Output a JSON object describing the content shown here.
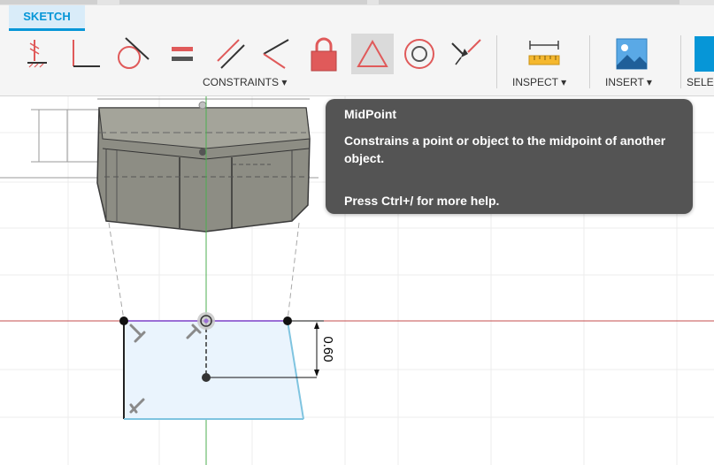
{
  "toolbar": {
    "active_tab": "SKETCH",
    "groups": {
      "constraints": "CONSTRAINTS ▾",
      "inspect": "INSPECT ▾",
      "insert": "INSERT ▾",
      "select": "SELE"
    },
    "tools": [
      {
        "name": "fix-unfix-icon"
      },
      {
        "name": "perpendicular-icon"
      },
      {
        "name": "tangent-icon"
      },
      {
        "name": "equal-icon"
      },
      {
        "name": "parallel-icon"
      },
      {
        "name": "coincident-icon"
      },
      {
        "name": "lock-icon"
      },
      {
        "name": "midpoint-icon",
        "active": true
      },
      {
        "name": "concentric-icon"
      },
      {
        "name": "collinear-icon"
      },
      {
        "name": "measure-icon"
      },
      {
        "name": "insert-image-icon"
      }
    ]
  },
  "tooltip": {
    "title": "MidPoint",
    "description": "Constrains a point or object to the midpoint of another object.",
    "hint": "Press Ctrl+/ for more help."
  },
  "canvas": {
    "dimension_value": "0.60"
  },
  "colors": {
    "accent": "#0696d7",
    "tooltip_bg": "#545454",
    "sketch_fill": "#eaf4fd",
    "profile_edge": "#7fc4e0",
    "axis_red": "#c44d4d",
    "axis_green": "#4caf50",
    "constraint_red": "#e05a5a"
  }
}
